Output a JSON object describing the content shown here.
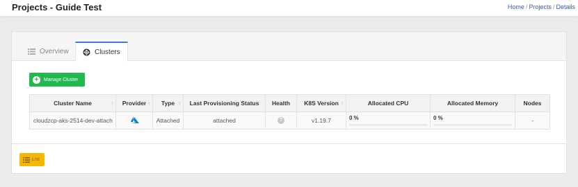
{
  "header": {
    "title": "Projects - Guide Test",
    "breadcrumb": {
      "home": "Home",
      "projects": "Projects",
      "current": "Details",
      "separator": "/"
    }
  },
  "tabs": [
    {
      "label": "Overview",
      "icon": "list-icon",
      "active": false
    },
    {
      "label": "Clusters",
      "icon": "kubernetes-icon",
      "active": true
    }
  ],
  "toolbar": {
    "manage_cluster_label": "Manage Cluster"
  },
  "table": {
    "columns": [
      "Cluster Name",
      "Provider",
      "Type",
      "Last Provisioning Status",
      "Health",
      "K8S Version",
      "Allocated CPU",
      "Allocated Memory",
      "Nodes"
    ],
    "sortable": [
      true,
      true,
      true,
      false,
      false,
      true,
      false,
      false,
      false
    ],
    "rows": [
      {
        "cluster_name": "cloudzcp-aks-2514-dev-attach",
        "provider_icon": "azure-icon",
        "type": "Attached",
        "status": "attached",
        "health_icon": "help-icon",
        "k8s_version": "v1.19.7",
        "cpu": "0 %",
        "cpu_fraction": 0,
        "memory": "0 %",
        "memory_fraction": 0,
        "nodes": "-"
      }
    ]
  },
  "footer": {
    "list_label": "List"
  },
  "colors": {
    "accent": "#3a7bd5",
    "success": "#21b94e",
    "warning": "#f5b800",
    "azure": "#0089d6"
  }
}
